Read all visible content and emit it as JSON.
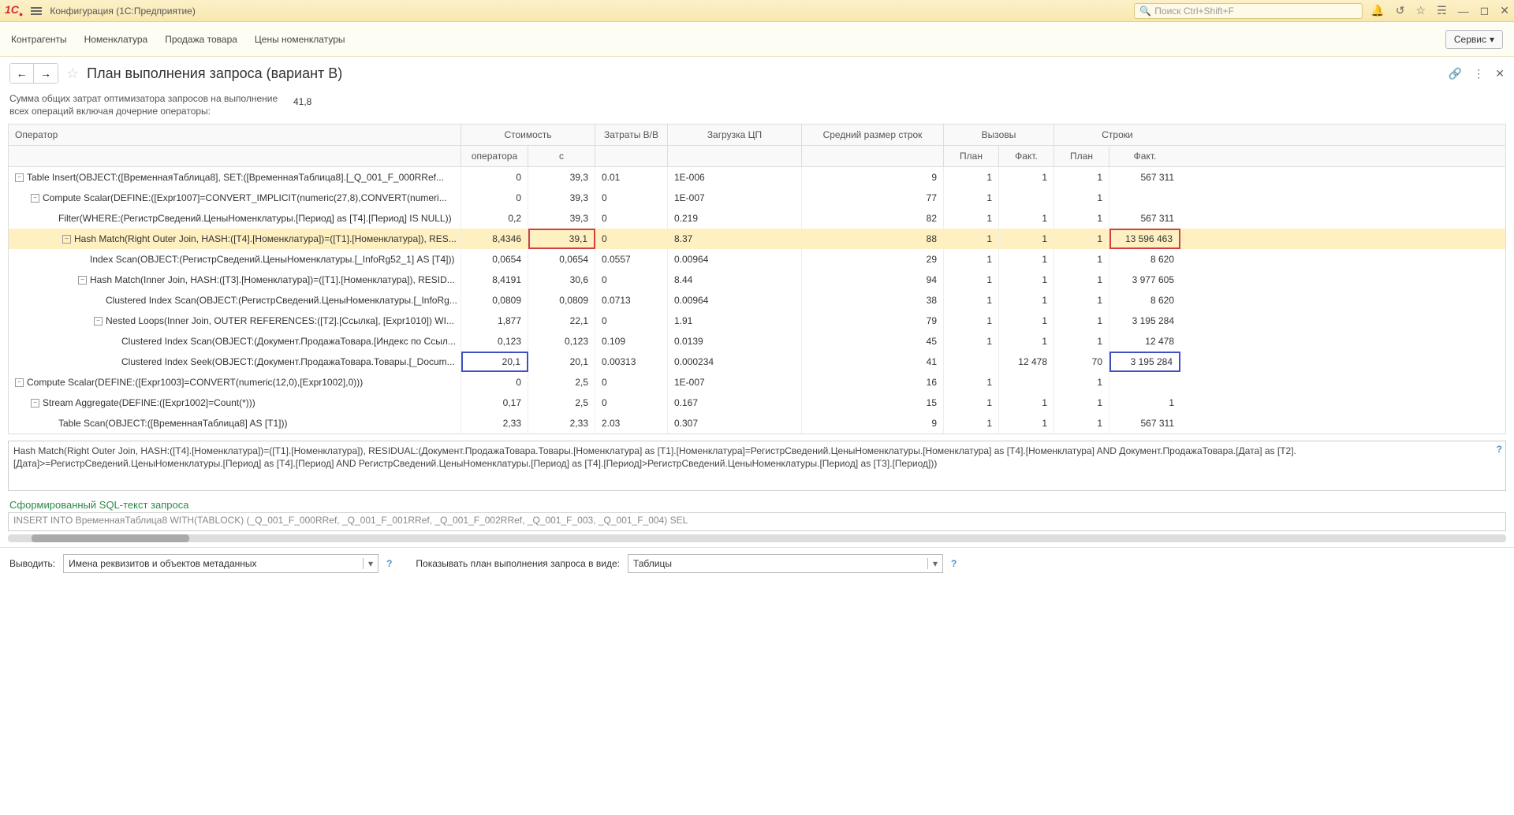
{
  "titlebar": {
    "app_title": "Конфигурация (1С:Предприятие)",
    "search_placeholder": "Поиск Ctrl+Shift+F"
  },
  "menu": {
    "items": [
      "Контрагенты",
      "Номенклатура",
      "Продажа товара",
      "Цены номенклатуры"
    ],
    "service": "Сервис"
  },
  "page": {
    "title": "План выполнения запроса (вариант B)",
    "summary_label": "Сумма общих затрат оптимизатора запросов на выполнение всех операций включая дочерние операторы:",
    "summary_value": "41,8"
  },
  "headers": {
    "operator": "Оператор",
    "cost": "Стоимость",
    "cost_op": "оператора",
    "cost_c": "с",
    "io": "Затраты В/В",
    "cpu": "Загрузка ЦП",
    "rowsize": "Средний размер строк",
    "calls": "Вызовы",
    "plan": "План",
    "fact": "Факт.",
    "rows": "Строки"
  },
  "rows": [
    {
      "ind": 0,
      "tog": true,
      "op": "Table Insert(OBJECT:([ВременнаяТаблица8], SET:([ВременнаяТаблица8].[_Q_001_F_000RRef...",
      "c1": "0",
      "c2": "39,3",
      "io": "0.01",
      "cpu": "1E-006",
      "rsz": "9",
      "cp": "1",
      "cf": "1",
      "rp": "1",
      "rf": "567 311"
    },
    {
      "ind": 1,
      "tog": true,
      "op": "Compute Scalar(DEFINE:([Expr1007]=CONVERT_IMPLICIT(numeric(27,8),CONVERT(numeri...",
      "c1": "0",
      "c2": "39,3",
      "io": "0",
      "cpu": "1E-007",
      "rsz": "77",
      "cp": "1",
      "cf": "",
      "rp": "1",
      "rf": ""
    },
    {
      "ind": 2,
      "tog": false,
      "op": "Filter(WHERE:(РегистрСведений.ЦеныНоменклатуры.[Период] as [T4].[Период] IS NULL))",
      "c1": "0,2",
      "c2": "39,3",
      "io": "0",
      "cpu": "0.219",
      "rsz": "82",
      "cp": "1",
      "cf": "1",
      "rp": "1",
      "rf": "567 311"
    },
    {
      "ind": 3,
      "tog": true,
      "sel": true,
      "op": "Hash Match(Right Outer Join, HASH:([T4].[Номенклатура])=([T1].[Номенклатура]), RES...",
      "c1": "8,4346",
      "c2": "39,1",
      "c2hl": "red",
      "io": "0",
      "cpu": "8.37",
      "rsz": "88",
      "cp": "1",
      "cf": "1",
      "rp": "1",
      "rf": "13 596 463",
      "rfhl": "red"
    },
    {
      "ind": 4,
      "tog": false,
      "op": "Index Scan(OBJECT:(РегистрСведений.ЦеныНоменклатуры.[_InfoRg52_1] AS [T4]))",
      "c1": "0,0654",
      "c2": "0,0654",
      "io": "0.0557",
      "cpu": "0.00964",
      "rsz": "29",
      "cp": "1",
      "cf": "1",
      "rp": "1",
      "rf": "8 620"
    },
    {
      "ind": 4,
      "tog": true,
      "op": "Hash Match(Inner Join, HASH:([T3].[Номенклатура])=([T1].[Номенклатура]), RESID...",
      "c1": "8,4191",
      "c2": "30,6",
      "io": "0",
      "cpu": "8.44",
      "rsz": "94",
      "cp": "1",
      "cf": "1",
      "rp": "1",
      "rf": "3 977 605"
    },
    {
      "ind": 5,
      "tog": false,
      "op": "Clustered Index Scan(OBJECT:(РегистрСведений.ЦеныНоменклатуры.[_InfoRg...",
      "c1": "0,0809",
      "c2": "0,0809",
      "io": "0.0713",
      "cpu": "0.00964",
      "rsz": "38",
      "cp": "1",
      "cf": "1",
      "rp": "1",
      "rf": "8 620"
    },
    {
      "ind": 5,
      "tog": true,
      "op": "Nested Loops(Inner Join, OUTER REFERENCES:([T2].[Ссылка], [Expr1010]) WI...",
      "c1": "1,877",
      "c2": "22,1",
      "io": "0",
      "cpu": "1.91",
      "rsz": "79",
      "cp": "1",
      "cf": "1",
      "rp": "1",
      "rf": "3 195 284"
    },
    {
      "ind": 6,
      "tog": false,
      "op": "Clustered Index Scan(OBJECT:(Документ.ПродажаТовара.[Индекс по Ссыл...",
      "c1": "0,123",
      "c2": "0,123",
      "io": "0.109",
      "cpu": "0.0139",
      "rsz": "45",
      "cp": "1",
      "cf": "1",
      "rp": "1",
      "rf": "12 478"
    },
    {
      "ind": 6,
      "tog": false,
      "op": "Clustered Index Seek(OBJECT:(Документ.ПродажаТовара.Товары.[_Docum...",
      "c1": "20,1",
      "c1hl": "blue",
      "c2": "20,1",
      "io": "0.00313",
      "cpu": "0.000234",
      "rsz": "41",
      "cp": "",
      "cf": "12 478",
      "rp": "70",
      "rf": "3 195 284",
      "rfhl": "blue"
    },
    {
      "ind": 0,
      "tog": true,
      "op": "Compute Scalar(DEFINE:([Expr1003]=CONVERT(numeric(12,0),[Expr1002],0)))",
      "c1": "0",
      "c2": "2,5",
      "io": "0",
      "cpu": "1E-007",
      "rsz": "16",
      "cp": "1",
      "cf": "",
      "rp": "1",
      "rf": ""
    },
    {
      "ind": 1,
      "tog": true,
      "op": "Stream Aggregate(DEFINE:([Expr1002]=Count(*)))",
      "c1": "0,17",
      "c2": "2,5",
      "io": "0",
      "cpu": "0.167",
      "rsz": "15",
      "cp": "1",
      "cf": "1",
      "rp": "1",
      "rf": "1"
    },
    {
      "ind": 2,
      "tog": false,
      "op": "Table Scan(OBJECT:([ВременнаяТаблица8] AS [T1]))",
      "c1": "2,33",
      "c2": "2,33",
      "io": "2.03",
      "cpu": "0.307",
      "rsz": "9",
      "cp": "1",
      "cf": "1",
      "rp": "1",
      "rf": "567 311"
    }
  ],
  "detail": "Hash Match(Right Outer Join, HASH:([T4].[Номенклатура])=([T1].[Номенклатура]), RESIDUAL:(Документ.ПродажаТовара.Товары.[Номенклатура] as [T1].[Номенклатура]=РегистрСведений.ЦеныНоменклатуры.[Номенклатура] as [T4].[Номенклатура] AND Документ.ПродажаТовара.[Дата] as [T2].[Дата]>=РегистрСведений.ЦеныНоменклатуры.[Период] as [T4].[Период] AND РегистрСведений.ЦеныНоменклатуры.[Период] as [T4].[Период]>РегистрСведений.ЦеныНоменклатуры.[Период] as [T3].[Период]))",
  "sql_title": "Сформированный SQL-текст запроса",
  "sql_text": "INSERT INTO ВременнаяТаблица8 WITH(TABLOCK) (_Q_001_F_000RRef, _Q_001_F_001RRef, _Q_001_F_002RRef, _Q_001_F_003, _Q_001_F_004) SEL",
  "footer": {
    "output_label": "Выводить:",
    "output_value": "Имена реквизитов и объектов метаданных",
    "plan_label": "Показывать план выполнения запроса в виде:",
    "plan_value": "Таблицы"
  }
}
